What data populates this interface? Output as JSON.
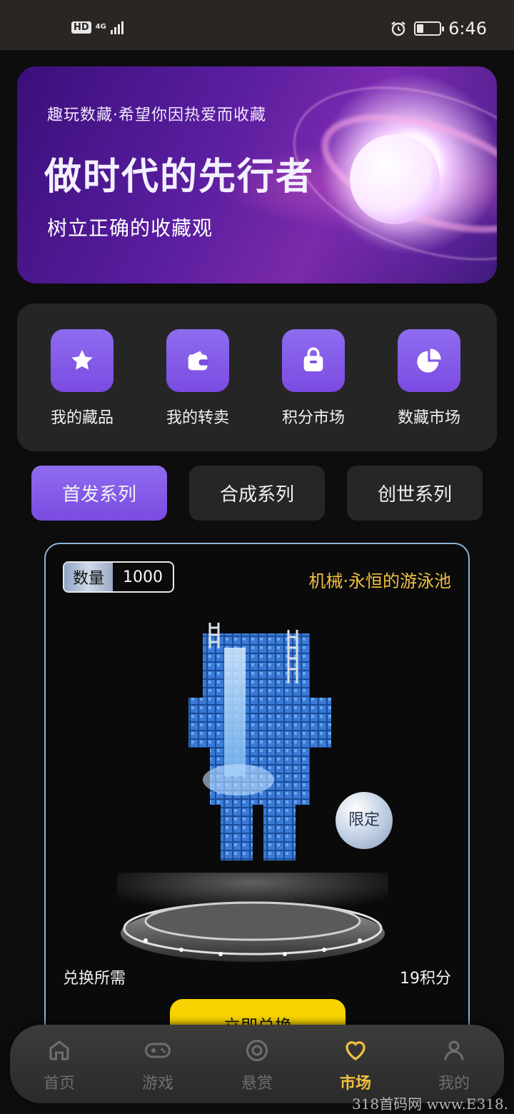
{
  "status_bar": {
    "hd": "HD",
    "network": "4G",
    "time": "6:46",
    "battery_level": 0.3
  },
  "banner": {
    "subtitle": "趣玩数藏·希望你因热爱而收藏",
    "title": "做时代的先行者",
    "subtitle2": "树立正确的收藏观"
  },
  "quick_actions": [
    {
      "label": "我的藏品",
      "icon": "star-icon"
    },
    {
      "label": "我的转卖",
      "icon": "wallet-icon"
    },
    {
      "label": "积分市场",
      "icon": "shopping-bag-icon"
    },
    {
      "label": "数藏市场",
      "icon": "pie-chart-icon"
    }
  ],
  "tabs": [
    {
      "label": "首发系列",
      "active": true
    },
    {
      "label": "合成系列",
      "active": false
    },
    {
      "label": "创世系列",
      "active": false
    }
  ],
  "product": {
    "qty_label": "数量",
    "qty_value": "1000",
    "name": "机械·永恒的游泳池",
    "badge": "限定",
    "need_label": "兑换所需",
    "need_value": "19积分",
    "button": "立即兑换"
  },
  "bottom_nav": [
    {
      "label": "首页",
      "icon": "home-icon",
      "active": false
    },
    {
      "label": "游戏",
      "icon": "gamepad-icon",
      "active": false
    },
    {
      "label": "悬赏",
      "icon": "target-icon",
      "active": false
    },
    {
      "label": "市场",
      "icon": "heart-icon",
      "active": true
    },
    {
      "label": "我的",
      "icon": "user-icon",
      "active": false
    }
  ],
  "watermark": "318首码网 www.E318.",
  "colors": {
    "accent_purple": "#7a4be0",
    "accent_yellow": "#f0c040",
    "button_yellow": "#f5d200",
    "background": "#0d0d0d",
    "panel": "#252525"
  }
}
